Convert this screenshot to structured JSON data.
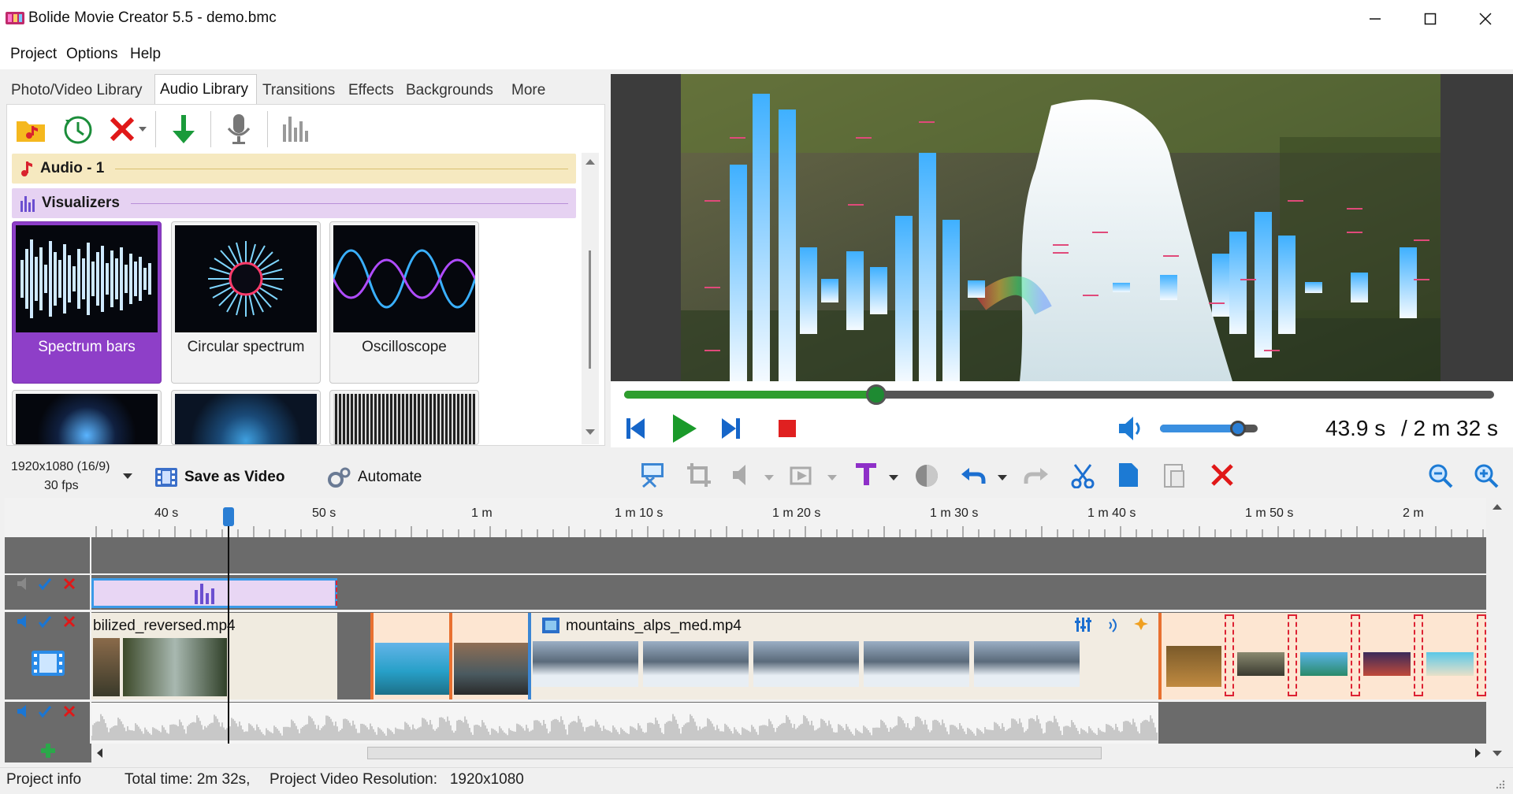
{
  "window": {
    "title": "Bolide Movie Creator 5.5 - demo.bmc"
  },
  "menu": {
    "items": [
      "Project",
      "Options",
      "Help"
    ]
  },
  "library": {
    "tabs": [
      "Photo/Video Library",
      "Audio Library",
      "Transitions",
      "Effects",
      "Backgrounds",
      "More"
    ],
    "active_tab": "Audio Library",
    "groups": {
      "audio": "Audio - 1",
      "visualizers": "Visualizers"
    },
    "tiles": [
      "Spectrum bars",
      "Circular spectrum",
      "Oscilloscope"
    ],
    "selected_tile": "Spectrum bars"
  },
  "toolbar": {
    "resolution": "1920x1080 (16/9)",
    "fps": "30 fps",
    "save_label": "Save as Video",
    "automate_label": "Automate"
  },
  "player": {
    "current_time": "43.9 s",
    "total_time": "/ 2 m 32 s",
    "progress": 0.29,
    "volume": 0.8
  },
  "timeline": {
    "ruler_labels": [
      "40 s",
      "50 s",
      "1 m",
      "1 m 10 s",
      "1 m 20 s",
      "1 m 30 s",
      "1 m 40 s",
      "1 m 50 s",
      "2 m"
    ],
    "clips": {
      "clip1": "bilized_reversed.mp4",
      "clip2": "mountains_alps_med.mp4"
    }
  },
  "status": {
    "project_info": "Project info",
    "total_time": "Total time: 2m 32s,",
    "resolution": "Project Video Resolution:   1920x1080"
  },
  "colors": {
    "accent": "#8e3fc8",
    "progress": "#2e9e2e",
    "play": "#1a9a2a",
    "stop": "#e02020",
    "delete": "#e01818"
  }
}
